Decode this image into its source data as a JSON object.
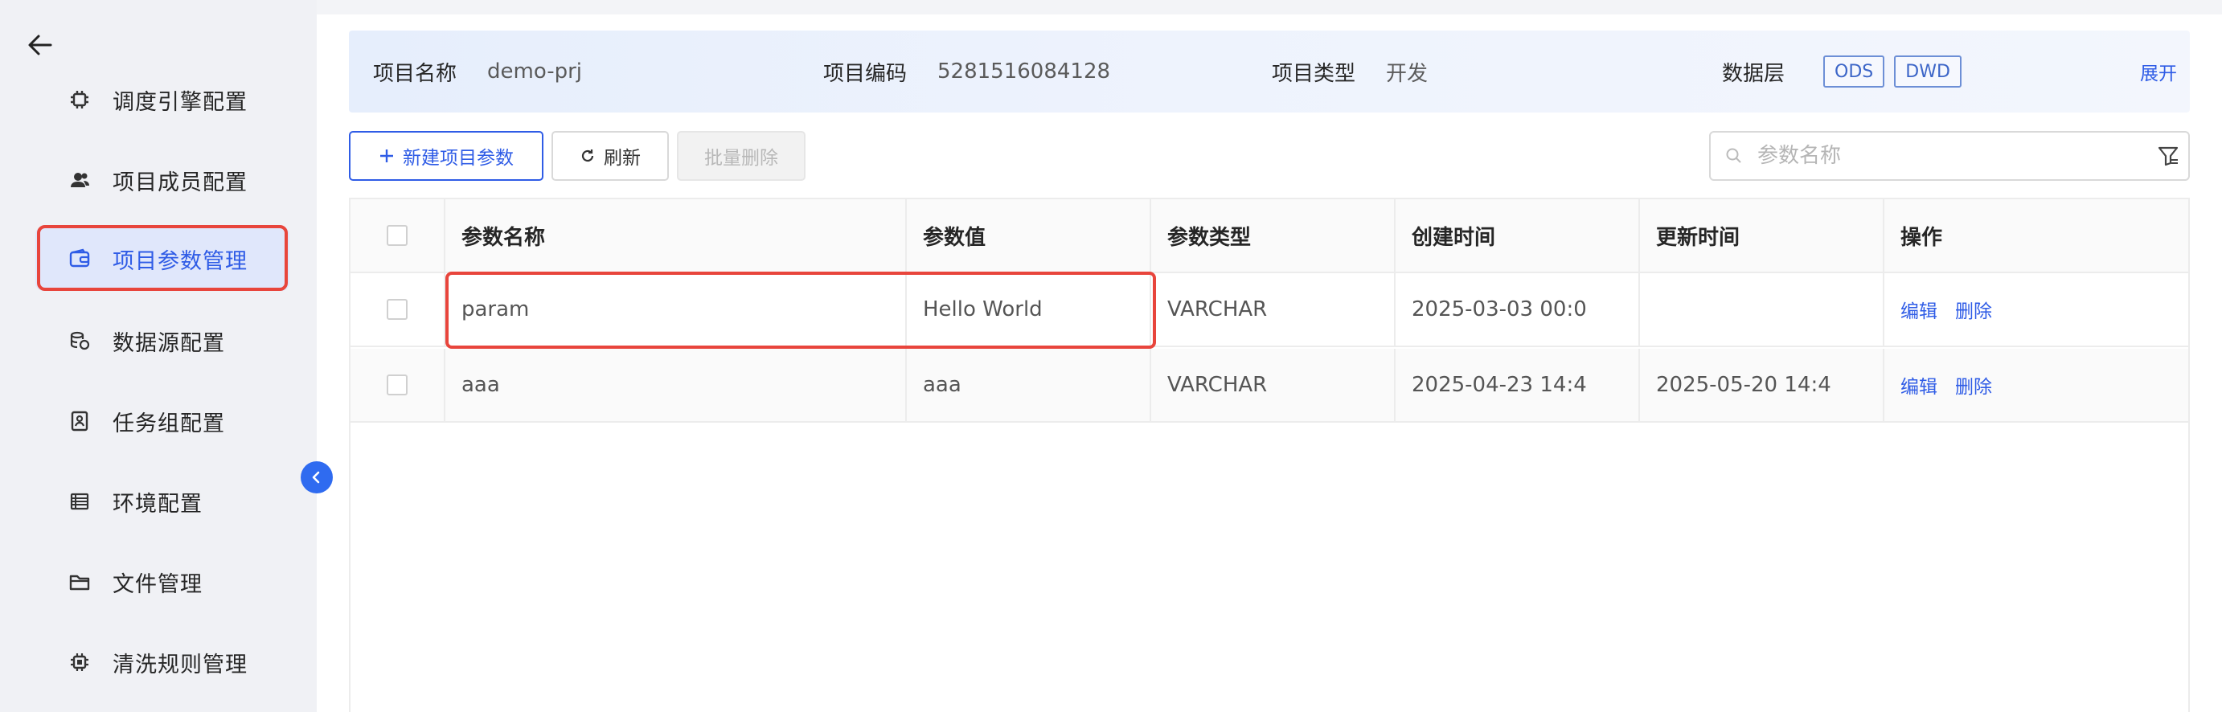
{
  "sidebar": {
    "items": [
      {
        "label": "调度引擎配置",
        "icon": "cpu-icon"
      },
      {
        "label": "项目成员配置",
        "icon": "user-group-icon"
      },
      {
        "label": "项目参数管理",
        "icon": "wallet-icon",
        "active": true
      },
      {
        "label": "数据源配置",
        "icon": "database-icon"
      },
      {
        "label": "任务组配置",
        "icon": "id-card-icon"
      },
      {
        "label": "环境配置",
        "icon": "list-icon"
      },
      {
        "label": "文件管理",
        "icon": "folder-icon"
      },
      {
        "label": "清洗规则管理",
        "icon": "chip-icon"
      }
    ]
  },
  "info": {
    "project_name_label": "项目名称",
    "project_name": "demo-prj",
    "project_code_label": "项目编码",
    "project_code": "5281516084128",
    "project_type_label": "项目类型",
    "project_type": "开发",
    "data_layer_label": "数据层",
    "tags": [
      "ODS",
      "DWD"
    ],
    "expand": "展开"
  },
  "toolbar": {
    "new_label": "新建项目参数",
    "refresh_label": "刷新",
    "batch_delete_label": "批量删除",
    "search_placeholder": "参数名称"
  },
  "table": {
    "headers": [
      "参数名称",
      "参数值",
      "参数类型",
      "创建时间",
      "更新时间",
      "操作"
    ],
    "rows": [
      {
        "name": "param",
        "value": "Hello World",
        "type": "VARCHAR",
        "created": "2025-03-03 00:0",
        "updated": ""
      },
      {
        "name": "aaa",
        "value": "aaa",
        "type": "VARCHAR",
        "created": "2025-04-23 14:4",
        "updated": "2025-05-20 14:4"
      }
    ],
    "edit_label": "编辑",
    "delete_label": "删除"
  },
  "colors": {
    "accent": "#2f5ce6",
    "highlight": "#e8453c"
  }
}
